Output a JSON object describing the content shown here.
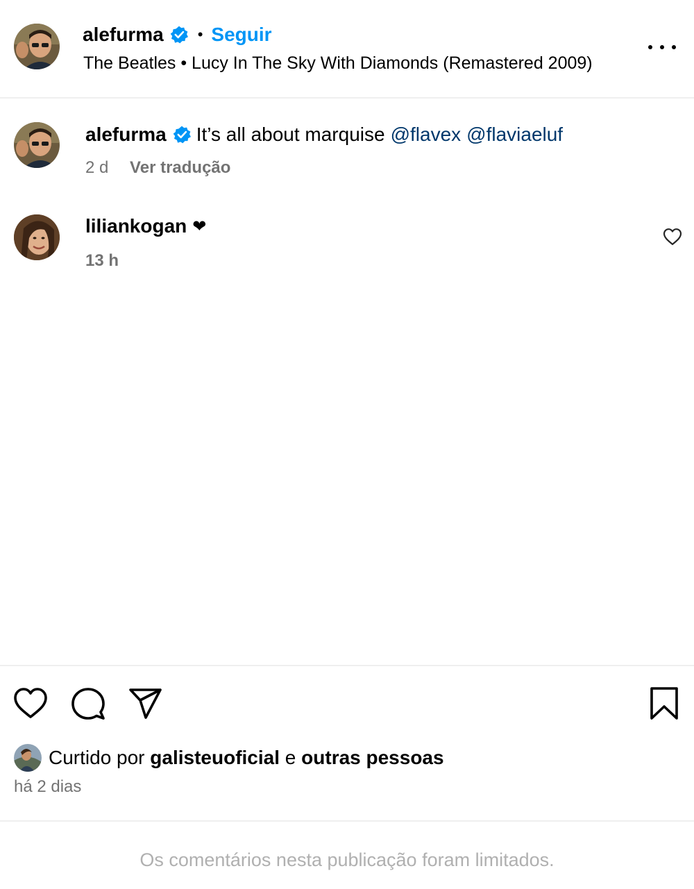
{
  "header": {
    "username": "alefurma",
    "separator": "•",
    "follow_label": "Seguir",
    "song": "The Beatles • Lucy In The Sky With Diamonds (Remastered 2009)"
  },
  "caption": {
    "username": "alefurma",
    "text": "It’s all about marquise",
    "mentions": [
      "@flavex",
      "@flaviaeluf"
    ],
    "time": "2 d",
    "translate_label": "Ver tradução"
  },
  "comment": {
    "username": "liliankogan",
    "text": "❤",
    "time": "13 h"
  },
  "likes": {
    "prefix": "Curtido por",
    "user": "galisteuoficial",
    "conj": "e",
    "others": "outras pessoas",
    "when": "há 2 dias"
  },
  "footer": {
    "limited_text": "Os comentários nesta publicação foram limitados."
  },
  "colors": {
    "accent": "#0095f6",
    "mention": "#00376b",
    "muted": "#737373",
    "divider": "#efefef"
  }
}
